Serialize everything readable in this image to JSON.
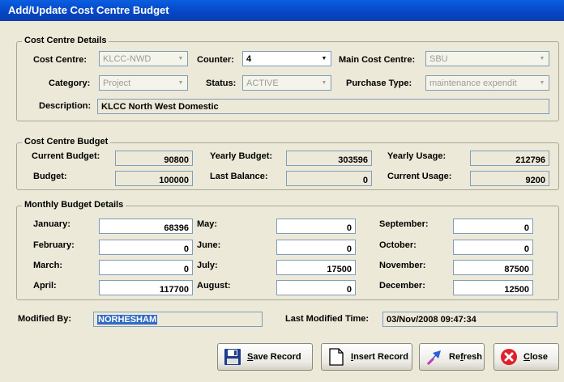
{
  "window": {
    "title": "Add/Update Cost Centre Budget"
  },
  "cost_centre_details": {
    "legend": "Cost Centre Details",
    "cost_centre_label": "Cost Centre:",
    "cost_centre_value": "KLCC-NWD",
    "counter_label": "Counter:",
    "counter_value": "4",
    "main_cost_centre_label": "Main Cost Centre:",
    "main_cost_centre_value": "SBU",
    "category_label": "Category:",
    "category_value": "Project",
    "status_label": "Status:",
    "status_value": "ACTIVE",
    "purchase_type_label": "Purchase Type:",
    "purchase_type_value": "maintenance expendit",
    "description_label": "Description:",
    "description_value": "KLCC North West Domestic"
  },
  "cost_centre_budget": {
    "legend": "Cost Centre Budget",
    "current_budget_label": "Current Budget:",
    "current_budget_value": "90800",
    "yearly_budget_label": "Yearly Budget:",
    "yearly_budget_value": "303596",
    "yearly_usage_label": "Yearly Usage:",
    "yearly_usage_value": "212796",
    "budget_label": "Budget:",
    "budget_value": "100000",
    "last_balance_label": "Last Balance:",
    "last_balance_value": "0",
    "current_usage_label": "Current Usage:",
    "current_usage_value": "9200"
  },
  "monthly_budget": {
    "legend": "Monthly Budget Details",
    "months": [
      {
        "label": "January:",
        "value": "68396"
      },
      {
        "label": "February:",
        "value": "0"
      },
      {
        "label": "March:",
        "value": "0"
      },
      {
        "label": "April:",
        "value": "117700"
      },
      {
        "label": "May:",
        "value": "0"
      },
      {
        "label": "June:",
        "value": "0"
      },
      {
        "label": "July:",
        "value": "17500"
      },
      {
        "label": "August:",
        "value": "0"
      },
      {
        "label": "September:",
        "value": "0"
      },
      {
        "label": "October:",
        "value": "0"
      },
      {
        "label": "November:",
        "value": "87500"
      },
      {
        "label": "December:",
        "value": "12500"
      }
    ]
  },
  "footer": {
    "modified_by_label": "Modified By:",
    "modified_by_value": "NORHESHAM",
    "last_modified_label": "Last Modified Time:",
    "last_modified_value": "03/Nov/2008 09:47:34"
  },
  "buttons": {
    "save": {
      "mnemonic": "S",
      "rest": "ave Record",
      "icon": "floppy-disk-icon"
    },
    "insert": {
      "mnemonic": "I",
      "rest": "nsert Record",
      "icon": "blank-document-icon"
    },
    "refresh": {
      "pre": "Re",
      "mnemonic": "f",
      "rest": "resh",
      "icon": "refresh-arrows-icon"
    },
    "close": {
      "mnemonic": "C",
      "rest": "lose",
      "icon": "close-red-x-icon"
    }
  }
}
